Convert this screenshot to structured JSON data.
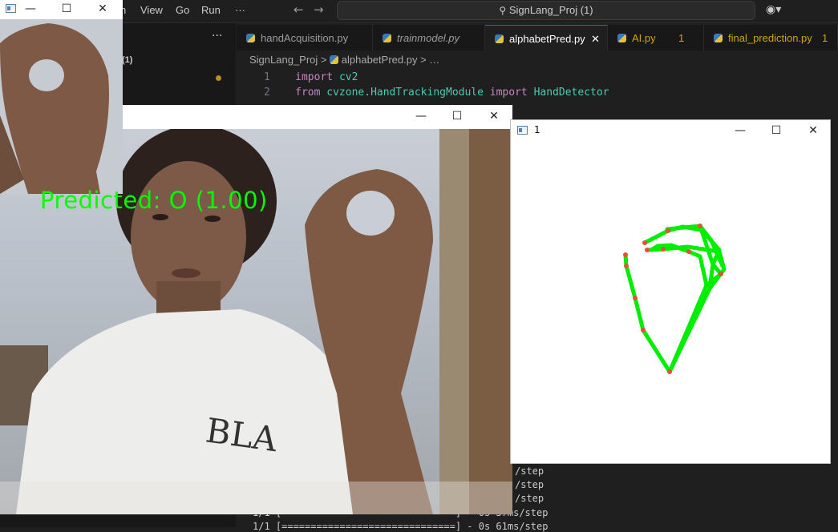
{
  "vscode": {
    "menu": [
      "n",
      "View",
      "Go",
      "Run",
      "···"
    ],
    "search": "SignLang_Proj (1)",
    "explorer": {
      "more": "···",
      "folder_badge": "(1)"
    },
    "tabs": [
      {
        "label": "handAcquisition.py",
        "active": false,
        "badge": ""
      },
      {
        "label": "trainmodel.py",
        "active": false,
        "badge": ""
      },
      {
        "label": "alphabetPred.py",
        "active": true,
        "badge": ""
      },
      {
        "label": "AI.py",
        "active": false,
        "badge": "1"
      },
      {
        "label": "final_prediction.py",
        "active": false,
        "badge": "1"
      }
    ],
    "close_glyph": "✕",
    "breadcrumb": {
      "folder": "SignLang_Proj",
      "sep": ">",
      "file": "alphabetPred.py",
      "more": "> …"
    },
    "code": {
      "line1_num": "1",
      "line1_kw": "import",
      "line1_mod": "cv2",
      "line2_num": "2",
      "line2_kw1": "from",
      "line2_mod": "cvzone.HandTrackingModule",
      "line2_kw2": "import",
      "line2_cls": "HandDetector"
    },
    "terminal": [
      "/step",
      "/step",
      "/step",
      "1/1 [==============================] - 0s 37ms/step",
      "1/1 [==============================] - 0s 61ms/step"
    ]
  },
  "small_window": {
    "title": "",
    "min": "—",
    "max": "☐",
    "close": "✕"
  },
  "main_window": {
    "title": "",
    "min": "—",
    "max": "☐",
    "close": "✕",
    "prediction": "Predicted: O (1.00)"
  },
  "skeleton_window": {
    "title": "1",
    "min": "—",
    "max": "☐",
    "close": "✕"
  },
  "colors": {
    "prediction_text": "#00ff00",
    "skeleton": "#00ee00",
    "joint": "#e0533a"
  }
}
